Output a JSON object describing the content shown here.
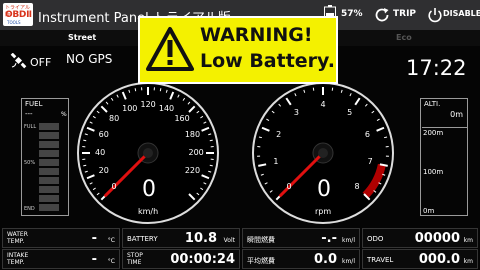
{
  "titlebar": {
    "logo_line1": "トライアル版",
    "logo_line2": "OBDⅡ",
    "logo_line3": "TOOLS",
    "title": "Instrument Panel トライアル版",
    "battery_pct": "57%",
    "trip_label": "TRIP",
    "disable_label": "DISABLE"
  },
  "tabs": {
    "street": "Street",
    "eco": "Eco"
  },
  "gps": {
    "state": "OFF",
    "status": "NO GPS"
  },
  "clock": "17:22",
  "warning": {
    "title": "WARNING!",
    "message": "Low Battery."
  },
  "speedometer": {
    "ticks": [
      "0",
      "20",
      "40",
      "60",
      "80",
      "100",
      "120",
      "140",
      "160",
      "180",
      "200",
      "220"
    ],
    "value": "0",
    "unit": "km/h",
    "max": 240
  },
  "tachometer": {
    "ticks": [
      "0",
      "1",
      "2",
      "3",
      "4",
      "5",
      "6",
      "7",
      "8"
    ],
    "value": "0",
    "unit": "rpm",
    "max": 8,
    "redline_from": 7
  },
  "fuel": {
    "label": "FUEL",
    "value": "---",
    "unit": "%",
    "full": "FULL",
    "half": "50%",
    "end": "END"
  },
  "altitude": {
    "label": "ALTI.",
    "value": "0m",
    "ticks": [
      "200m",
      "100m",
      "0m"
    ]
  },
  "info": {
    "water_temp": {
      "label1": "WATER",
      "label2": "TEMP.",
      "value": "-",
      "unit": "°C"
    },
    "intake_temp": {
      "label1": "INTAKE",
      "label2": "TEMP.",
      "value": "-",
      "unit": "°C"
    },
    "battery": {
      "label": "BATTERY",
      "value": "10.8",
      "unit": "Volt"
    },
    "stop_time": {
      "label1": "STOP",
      "label2": "TIME",
      "value": "00:00:24"
    },
    "instant_fuel": {
      "label": "瞬間燃費",
      "value": "-.-",
      "unit": "km/l"
    },
    "avg_fuel": {
      "label": "平均燃費",
      "value": "0.0",
      "unit": "km/l"
    },
    "odo": {
      "label": "ODO",
      "value": "00000",
      "unit": "km"
    },
    "travel": {
      "label": "TRAVEL",
      "value": "000.0",
      "unit": "km"
    }
  },
  "colors": {
    "warning_bg": "#f4f100",
    "needle": "#e01010",
    "redzone": "#b00000"
  }
}
